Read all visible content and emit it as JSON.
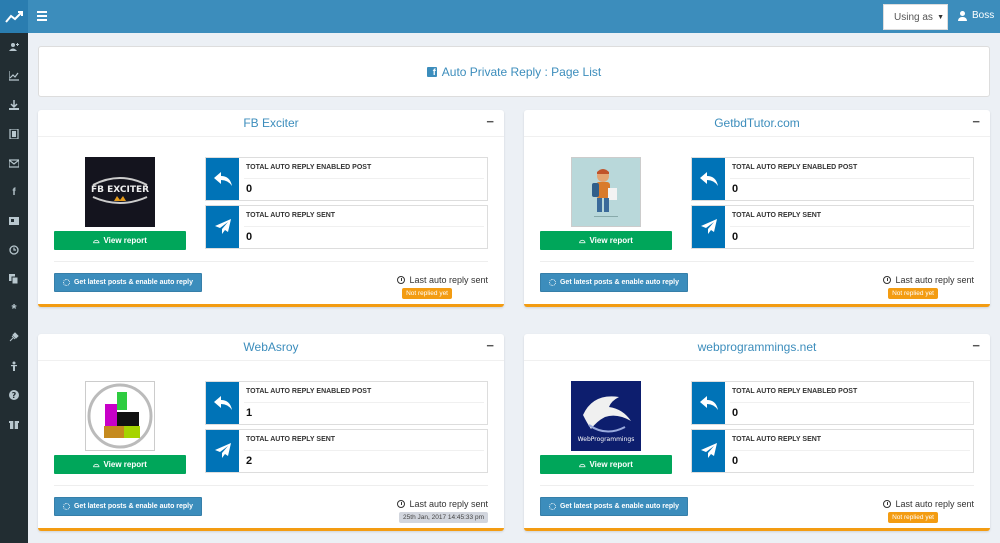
{
  "header": {
    "using_as": "Using as",
    "user_name": "Boss"
  },
  "colors": {
    "primary": "#3c8dbc",
    "success": "#00a65a",
    "warning": "#f39c12",
    "sidebar": "#222d32",
    "stat_icon_bg": "#0073b7"
  },
  "sidebar": {
    "items": [
      {
        "icon": "add-user-icon"
      },
      {
        "icon": "line-chart-icon"
      },
      {
        "icon": "download-icon"
      },
      {
        "icon": "film-icon"
      },
      {
        "icon": "envelope-icon"
      },
      {
        "icon": "facebook-icon"
      },
      {
        "icon": "id-card-icon"
      },
      {
        "icon": "clock-icon"
      },
      {
        "icon": "copy-icon"
      },
      {
        "icon": "asterisk-icon"
      },
      {
        "icon": "plug-icon"
      },
      {
        "icon": "child-icon"
      },
      {
        "icon": "question-icon"
      },
      {
        "icon": "gift-icon"
      }
    ]
  },
  "page": {
    "title": "Auto Private Reply : Page List"
  },
  "labels": {
    "collapse": "−",
    "view_report": "View report",
    "enabled_post": "TOTAL AUTO REPLY ENABLED POST",
    "reply_sent": "TOTAL AUTO REPLY SENT",
    "get_posts": "Get latest posts & enable auto reply",
    "last_sent": "Last auto reply sent"
  },
  "pages": [
    {
      "name": "FB Exciter",
      "logo": "FB EXCITER",
      "enabled_post": "0",
      "reply_sent": "0",
      "last_reply": "Not replied yet",
      "last_reply_status": "none"
    },
    {
      "name": "GetbdTutor.com",
      "logo": "tutor-illustration",
      "enabled_post": "0",
      "reply_sent": "0",
      "last_reply": "Not replied yet",
      "last_reply_status": "none"
    },
    {
      "name": "WebAsroy",
      "logo": "webasroy-logo",
      "enabled_post": "1",
      "reply_sent": "2",
      "last_reply": "25th Jan, 2017 14:45:33 pm",
      "last_reply_status": "date"
    },
    {
      "name": "webprogrammings.net",
      "logo": "WebProgrammings",
      "enabled_post": "0",
      "reply_sent": "0",
      "last_reply": "Not replied yet",
      "last_reply_status": "none"
    }
  ]
}
